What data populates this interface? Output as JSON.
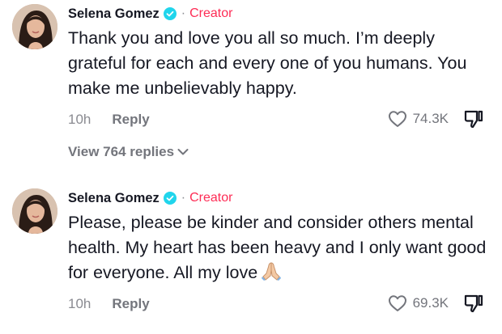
{
  "comments": [
    {
      "author": "Selena Gomez",
      "badge_separator": "·",
      "creator_label": "Creator",
      "text": "Thank you and love you all so much. I’m deeply grateful for each and every one of you humans. You make me unbelievably happy.",
      "time": "10h",
      "reply_label": "Reply",
      "likes": "74.3K",
      "view_replies": "View 764 replies"
    },
    {
      "author": "Selena Gomez",
      "badge_separator": "·",
      "creator_label": "Creator",
      "text": "Please, please be kinder and consider others mental health. My heart has been heavy and I only want good for everyone. All my love",
      "time": "10h",
      "reply_label": "Reply",
      "likes": "69.3K"
    }
  ],
  "icons": {
    "verified": "verified-badge-icon",
    "like": "heart-outline-icon",
    "dislike": "thumbs-down-icon",
    "expand": "chevron-down-icon",
    "emoji": "folded-hands-emoji"
  },
  "colors": {
    "creator": "#fe2c55",
    "verified": "#20d5ec",
    "secondary_text": "#73757c"
  }
}
